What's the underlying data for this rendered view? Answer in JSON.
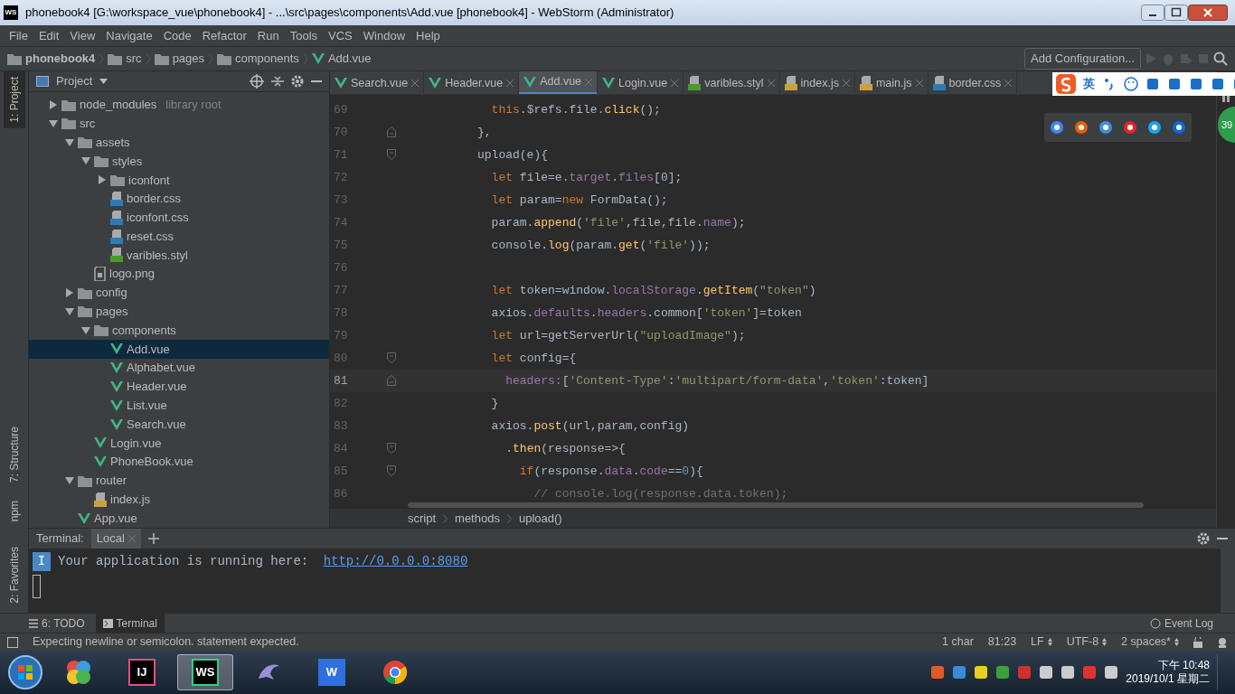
{
  "window": {
    "title": "phonebook4 [G:\\workspace_vue\\phonebook4] - ...\\src\\pages\\components\\Add.vue [phonebook4] - WebStorm (Administrator)",
    "logo": "WS"
  },
  "menu": [
    "File",
    "Edit",
    "View",
    "Navigate",
    "Code",
    "Refactor",
    "Run",
    "Tools",
    "VCS",
    "Window",
    "Help"
  ],
  "nav_bar": {
    "crumbs": [
      {
        "label": "phonebook4",
        "kind": "folder"
      },
      {
        "label": "src",
        "kind": "folder"
      },
      {
        "label": "pages",
        "kind": "folder"
      },
      {
        "label": "components",
        "kind": "folder"
      },
      {
        "label": "Add.vue",
        "kind": "vue"
      }
    ],
    "run_config": "Add Configuration..."
  },
  "left_tools": [
    {
      "label": "1: Project",
      "selected": true,
      "kind": "top"
    },
    {
      "label": "7: Structure",
      "selected": false,
      "kind": "bottom"
    },
    {
      "label": "npm",
      "selected": false,
      "kind": "bottom"
    },
    {
      "label": "2: Favorites",
      "selected": false,
      "kind": "terminal"
    }
  ],
  "project": {
    "title": "Project",
    "tree": [
      {
        "label": "node_modules",
        "kind": "folder",
        "note": "library root",
        "expanded": false,
        "selected": false
      },
      {
        "label": "src",
        "kind": "folder",
        "expanded": true,
        "selected": false,
        "children": [
          {
            "label": "assets",
            "kind": "folder",
            "expanded": true,
            "selected": false,
            "children": [
              {
                "label": "styles",
                "kind": "folder",
                "expanded": true,
                "selected": false,
                "children": [
                  {
                    "label": "iconfont",
                    "kind": "folder",
                    "expanded": false,
                    "selected": false
                  },
                  {
                    "label": "border.css",
                    "kind": "css",
                    "selected": false
                  },
                  {
                    "label": "iconfont.css",
                    "kind": "css",
                    "selected": false
                  },
                  {
                    "label": "reset.css",
                    "kind": "css",
                    "selected": false
                  },
                  {
                    "label": "varibles.styl",
                    "kind": "styl",
                    "selected": false
                  }
                ]
              },
              {
                "label": "logo.png",
                "kind": "png",
                "selected": false
              }
            ]
          },
          {
            "label": "config",
            "kind": "folder",
            "expanded": false,
            "selected": false
          },
          {
            "label": "pages",
            "kind": "folder",
            "expanded": true,
            "selected": false,
            "children": [
              {
                "label": "components",
                "kind": "folder",
                "expanded": true,
                "selected": false,
                "children": [
                  {
                    "label": "Add.vue",
                    "kind": "vue",
                    "selected": true
                  },
                  {
                    "label": "Alphabet.vue",
                    "kind": "vue",
                    "selected": false
                  },
                  {
                    "label": "Header.vue",
                    "kind": "vue",
                    "selected": false
                  },
                  {
                    "label": "List.vue",
                    "kind": "vue",
                    "selected": false
                  },
                  {
                    "label": "Search.vue",
                    "kind": "vue",
                    "selected": false
                  }
                ]
              },
              {
                "label": "Login.vue",
                "kind": "vue",
                "selected": false
              },
              {
                "label": "PhoneBook.vue",
                "kind": "vue",
                "selected": false
              }
            ]
          },
          {
            "label": "router",
            "kind": "folder",
            "expanded": true,
            "selected": false,
            "children": [
              {
                "label": "index.js",
                "kind": "js",
                "selected": false
              }
            ]
          },
          {
            "label": "App.vue",
            "kind": "vue",
            "selected": false
          }
        ]
      }
    ]
  },
  "editor_tabs": [
    {
      "label": "Search.vue",
      "kind": "vue",
      "selected": false
    },
    {
      "label": "Header.vue",
      "kind": "vue",
      "selected": false
    },
    {
      "label": "Add.vue",
      "kind": "vue",
      "selected": true
    },
    {
      "label": "Login.vue",
      "kind": "vue",
      "selected": false
    },
    {
      "label": "varibles.styl",
      "kind": "styl",
      "selected": false
    },
    {
      "label": "index.js",
      "kind": "js",
      "selected": false
    },
    {
      "label": "main.js",
      "kind": "js",
      "selected": false
    },
    {
      "label": "border.css",
      "kind": "css",
      "selected": false
    }
  ],
  "code": {
    "lines": [
      {
        "number": "69",
        "current": false,
        "fold_start": false,
        "fold_end": false,
        "segments": [
          {
            "text": "            this",
            "kind": "kw"
          },
          {
            "text": ".$refs.file.",
            "kind": "plain"
          },
          {
            "text": "click",
            "kind": "fn"
          },
          {
            "text": "();",
            "kind": "plain"
          }
        ]
      },
      {
        "number": "70",
        "current": false,
        "fold_start": false,
        "fold_end": true,
        "segments": [
          {
            "text": "          },",
            "kind": "plain"
          }
        ]
      },
      {
        "number": "71",
        "current": false,
        "fold_start": true,
        "fold_end": false,
        "segments": [
          {
            "text": "          upload(e){",
            "kind": "plain"
          }
        ]
      },
      {
        "number": "72",
        "current": false,
        "fold_start": false,
        "fold_end": false,
        "segments": [
          {
            "text": "            let ",
            "kind": "kw"
          },
          {
            "text": "file=e.",
            "kind": "plain"
          },
          {
            "text": "target",
            "kind": "prop"
          },
          {
            "text": ".",
            "kind": "plain"
          },
          {
            "text": "files",
            "kind": "prop"
          },
          {
            "text": "[0];",
            "kind": "plain"
          }
        ]
      },
      {
        "number": "73",
        "current": false,
        "fold_start": false,
        "fold_end": false,
        "segments": [
          {
            "text": "            let ",
            "kind": "kw"
          },
          {
            "text": "param=",
            "kind": "plain"
          },
          {
            "text": "new ",
            "kind": "kw"
          },
          {
            "text": "FormData();",
            "kind": "plain"
          }
        ]
      },
      {
        "number": "74",
        "current": false,
        "fold_start": false,
        "fold_end": false,
        "segments": [
          {
            "text": "            param.",
            "kind": "plain"
          },
          {
            "text": "append",
            "kind": "fn"
          },
          {
            "text": "(",
            "kind": "plain"
          },
          {
            "text": "'file'",
            "kind": "str"
          },
          {
            "text": ",file,file.",
            "kind": "plain"
          },
          {
            "text": "name",
            "kind": "prop"
          },
          {
            "text": ");",
            "kind": "plain"
          }
        ]
      },
      {
        "number": "75",
        "current": false,
        "fold_start": false,
        "fold_end": false,
        "segments": [
          {
            "text": "            console.",
            "kind": "plain"
          },
          {
            "text": "log",
            "kind": "fn"
          },
          {
            "text": "(param.",
            "kind": "plain"
          },
          {
            "text": "get",
            "kind": "fn"
          },
          {
            "text": "(",
            "kind": "plain"
          },
          {
            "text": "'file'",
            "kind": "str"
          },
          {
            "text": "));",
            "kind": "plain"
          }
        ]
      },
      {
        "number": "76",
        "current": false,
        "fold_start": false,
        "fold_end": false
      },
      {
        "number": "77",
        "current": false,
        "fold_start": false,
        "fold_end": false,
        "segments": [
          {
            "text": "            let ",
            "kind": "kw"
          },
          {
            "text": "token=window.",
            "kind": "plain"
          },
          {
            "text": "localStorage",
            "kind": "prop"
          },
          {
            "text": ".",
            "kind": "plain"
          },
          {
            "text": "getItem",
            "kind": "fn"
          },
          {
            "text": "(",
            "kind": "plain"
          },
          {
            "text": "\"token\"",
            "kind": "str"
          },
          {
            "text": ")",
            "kind": "plain"
          }
        ]
      },
      {
        "number": "78",
        "current": false,
        "fold_start": false,
        "fold_end": false,
        "segments": [
          {
            "text": "            axios.",
            "kind": "plain"
          },
          {
            "text": "defaults",
            "kind": "prop"
          },
          {
            "text": ".",
            "kind": "plain"
          },
          {
            "text": "headers",
            "kind": "prop"
          },
          {
            "text": ".common[",
            "kind": "plain"
          },
          {
            "text": "'token'",
            "kind": "str"
          },
          {
            "text": "]=token",
            "kind": "plain"
          }
        ]
      },
      {
        "number": "79",
        "current": false,
        "fold_start": false,
        "fold_end": false,
        "segments": [
          {
            "text": "            let ",
            "kind": "kw"
          },
          {
            "text": "url=getServerUrl(",
            "kind": "plain"
          },
          {
            "text": "\"uploadImage\"",
            "kind": "str"
          },
          {
            "text": ");",
            "kind": "plain"
          }
        ]
      },
      {
        "number": "80",
        "current": false,
        "fold_start": true,
        "fold_end": false,
        "segments": [
          {
            "text": "            let ",
            "kind": "kw"
          },
          {
            "text": "config={",
            "kind": "plain"
          }
        ]
      },
      {
        "number": "81",
        "current": true,
        "fold_start": false,
        "fold_end": true,
        "segments": [
          {
            "text": "              headers:",
            "kind": "prop"
          },
          {
            "text": "[",
            "kind": "plain"
          },
          {
            "text": "'Content-Type'",
            "kind": "str"
          },
          {
            "text": ":",
            "kind": "plain"
          },
          {
            "text": "'multipart/form-data'",
            "kind": "str"
          },
          {
            "text": ",",
            "kind": "plain"
          },
          {
            "text": "'token'",
            "kind": "str"
          },
          {
            "text": ":token]",
            "kind": "plain"
          }
        ]
      },
      {
        "number": "82",
        "current": false,
        "fold_start": false,
        "fold_end": false,
        "segments": [
          {
            "text": "            }",
            "kind": "plain"
          }
        ]
      },
      {
        "number": "83",
        "current": false,
        "fold_start": false,
        "fold_end": false,
        "segments": [
          {
            "text": "            axios.",
            "kind": "plain"
          },
          {
            "text": "post",
            "kind": "fn"
          },
          {
            "text": "(url,param,config)",
            "kind": "plain"
          }
        ]
      },
      {
        "number": "84",
        "current": false,
        "fold_start": true,
        "fold_end": false,
        "segments": [
          {
            "text": "              .",
            "kind": "plain"
          },
          {
            "text": "then",
            "kind": "fn"
          },
          {
            "text": "(response=>{",
            "kind": "plain"
          }
        ]
      },
      {
        "number": "85",
        "current": false,
        "fold_start": true,
        "fold_end": false,
        "segments": [
          {
            "text": "                if",
            "kind": "kw"
          },
          {
            "text": "(response.",
            "kind": "plain"
          },
          {
            "text": "data",
            "kind": "prop"
          },
          {
            "text": ".",
            "kind": "plain"
          },
          {
            "text": "code",
            "kind": "prop"
          },
          {
            "text": "==",
            "kind": "plain"
          },
          {
            "text": "0",
            "kind": "num"
          },
          {
            "text": "){",
            "kind": "plain"
          }
        ]
      },
      {
        "number": "86",
        "current": false,
        "fold_start": false,
        "fold_end": false,
        "segments": [
          {
            "text": "                  // console.log(response.data.token);",
            "kind": "comment"
          }
        ]
      }
    ]
  },
  "code_breadcrumbs": [
    "script",
    "methods",
    "upload()"
  ],
  "terminal": {
    "title": "Terminal:",
    "tabs": [
      {
        "label": "Local",
        "selected": true
      }
    ],
    "prompt": "I",
    "message": "Your application is running here: ",
    "link": "http://0.0.0.0:8080"
  },
  "tool_windows": [
    {
      "label": "6: TODO",
      "kind": "todo",
      "selected": false
    },
    {
      "label": "Terminal",
      "kind": "terminal",
      "selected": true
    }
  ],
  "event_log": "Event Log",
  "status_bar": {
    "message": "Expecting newline or semicolon. statement expected.",
    "items": [
      {
        "label": "1 char",
        "kind": "plain"
      },
      {
        "label": "81:23",
        "kind": "plain"
      },
      {
        "label": "LF",
        "kind": "choice"
      },
      {
        "label": "UTF-8",
        "kind": "choice"
      },
      {
        "label": "2 spaces*",
        "kind": "choice"
      }
    ]
  },
  "ime_bar": {
    "mode": "英"
  },
  "badge": "39",
  "taskbar": {
    "apps": [
      {
        "kind": "pinwheel",
        "active": false
      },
      {
        "kind": "intellij",
        "label": "IJ",
        "active": false
      },
      {
        "kind": "webstorm",
        "label": "WS",
        "active": true
      },
      {
        "kind": "dolphin",
        "active": false
      },
      {
        "kind": "wps",
        "label": "W",
        "active": false
      },
      {
        "kind": "chrome",
        "active": false
      }
    ],
    "time": "下午 10:48",
    "date": "2019/10/1 星期二"
  }
}
